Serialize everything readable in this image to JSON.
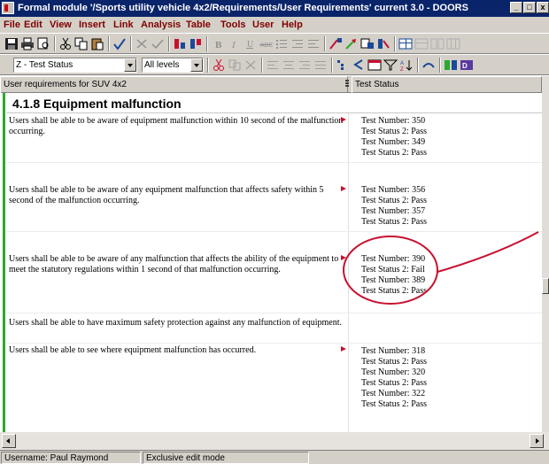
{
  "window": {
    "title": "Formal module '/Sports utility vehicle 4x2/Requirements/User Requirements' current 3.0 - DOORS",
    "minimize_glyph": "_",
    "maximize_glyph": "□",
    "close_glyph": "x"
  },
  "menu": {
    "items": [
      "File",
      "Edit",
      "View",
      "Insert",
      "Link",
      "Analysis",
      "Table",
      "Tools",
      "User",
      "Help"
    ]
  },
  "toolbar": {
    "view_select": "Z - Test Status",
    "level_select": "All levels"
  },
  "columns": {
    "main": "User requirements for SUV 4x2",
    "status": "Test Status"
  },
  "section": {
    "heading": "4.1.8 Equipment malfunction"
  },
  "requirements": [
    {
      "text": "Users shall be able to be aware of equipment malfunction within 10 second of the malfunction occurring.",
      "flag": true,
      "status": [
        "Test Number: 350",
        "Test Status 2: Pass",
        "Test Number: 349",
        "Test Status 2: Pass"
      ]
    },
    {
      "text": "Users shall be able to be aware of any equipment malfunction that affects safety within 5 second of the malfunction occurring.",
      "flag": true,
      "status": [
        "Test Number: 356",
        "Test Status 2: Pass",
        "Test Number: 357",
        "Test Status 2: Pass"
      ]
    },
    {
      "text": "Users shall be able to be aware of any malfunction that affects the ability of the equipment to meet the statutory regulations within 1 second of that malfunction occurring.",
      "flag": true,
      "status": [
        "Test Number: 390",
        "Test Status 2: Fail",
        "Test Number: 389",
        "Test Status 2: Pass"
      ]
    },
    {
      "text": "Users shall be able to have maximum safety protection against any malfunction of equipment.",
      "flag": false,
      "status": []
    },
    {
      "text": "Users shall be able to see where equipment malfunction has occurred.",
      "flag": true,
      "status": [
        "Test Number: 318",
        "Test Status 2: Pass",
        "Test Number: 320",
        "Test Status 2: Pass",
        "Test Number: 322",
        "Test Status 2: Pass"
      ]
    }
  ],
  "statusbar": {
    "username": "Username: Paul Raymond",
    "mode": "Exclusive edit mode"
  },
  "colors": {
    "title_bar": "#0a246a",
    "change_bar": "#2ca82c",
    "flag": "#c8102e",
    "annotation": "#c8102e"
  }
}
